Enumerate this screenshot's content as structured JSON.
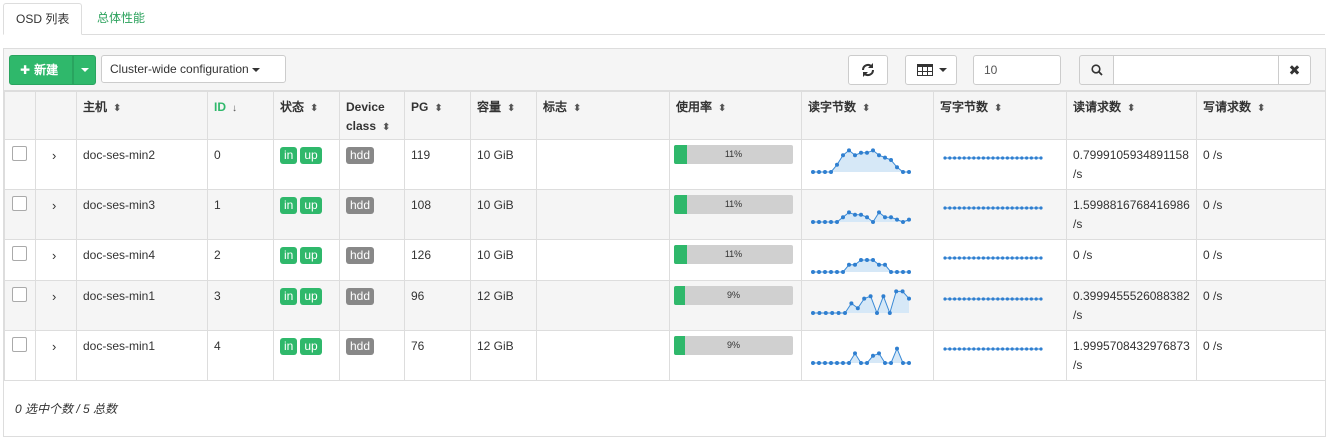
{
  "tabs": [
    {
      "label": "OSD 列表"
    },
    {
      "label": "总体性能"
    }
  ],
  "toolbar": {
    "new_label": "新建",
    "cluster_label": "Cluster-wide configuration",
    "page_size": "10",
    "search_placeholder": "",
    "clear_label": "✖"
  },
  "columns": [
    {
      "label": "",
      "key": "select"
    },
    {
      "label": "",
      "key": "expand"
    },
    {
      "label": "主机",
      "sort": "⬍"
    },
    {
      "label": "ID",
      "sort": "↓"
    },
    {
      "label": "状态",
      "sort": "⬍"
    },
    {
      "label": "Device class",
      "sort": "⬍"
    },
    {
      "label": "PG",
      "sort": "⬍"
    },
    {
      "label": "容量",
      "sort": "⬍"
    },
    {
      "label": "标志",
      "sort": "⬍"
    },
    {
      "label": "使用率",
      "sort": "⬍"
    },
    {
      "label": "读字节数",
      "sort": "⬍"
    },
    {
      "label": "写字节数",
      "sort": "⬍"
    },
    {
      "label": "读请求数",
      "sort": "⬍"
    },
    {
      "label": "写请求数",
      "sort": "⬍"
    }
  ],
  "rows": [
    {
      "host": "doc-ses-min2",
      "id": "0",
      "status": [
        "in",
        "up"
      ],
      "device_class": "hdd",
      "pg": "119",
      "size": "10 GiB",
      "flags": "",
      "usage_pct": 11,
      "usage_label": "11%",
      "read_bytes": [
        0,
        0,
        0,
        0,
        3,
        7,
        9,
        7,
        8,
        8,
        9,
        7,
        6,
        5,
        2,
        0,
        0
      ],
      "write_bytes": [
        1,
        1,
        1,
        1,
        1,
        1,
        1,
        1,
        1,
        1,
        1,
        1,
        1,
        1,
        1,
        1,
        1,
        1,
        1,
        1,
        1
      ],
      "read_ops": "0.7999105934891158 /s",
      "write_ops": "0 /s"
    },
    {
      "host": "doc-ses-min3",
      "id": "1",
      "status": [
        "in",
        "up"
      ],
      "device_class": "hdd",
      "pg": "108",
      "size": "10 GiB",
      "flags": "",
      "usage_pct": 11,
      "usage_label": "11%",
      "read_bytes": [
        0,
        0,
        0,
        0,
        0,
        2,
        4,
        3,
        3,
        2,
        0,
        4,
        2,
        2,
        1,
        0,
        1
      ],
      "write_bytes": [
        1,
        1,
        1,
        1,
        1,
        1,
        1,
        1,
        1,
        1,
        1,
        1,
        1,
        1,
        1,
        1,
        1,
        1,
        1,
        1,
        1
      ],
      "read_ops": "1.5998816768416986 /s",
      "write_ops": "0 /s"
    },
    {
      "host": "doc-ses-min4",
      "id": "2",
      "status": [
        "in",
        "up"
      ],
      "device_class": "hdd",
      "pg": "126",
      "size": "10 GiB",
      "flags": "",
      "usage_pct": 11,
      "usage_label": "11%",
      "read_bytes": [
        0,
        0,
        0,
        0,
        0,
        0,
        3,
        3,
        5,
        5,
        5,
        3,
        3,
        0,
        0,
        0,
        0
      ],
      "write_bytes": [
        1,
        1,
        1,
        1,
        1,
        1,
        1,
        1,
        1,
        1,
        1,
        1,
        1,
        1,
        1,
        1,
        1,
        1,
        1,
        1,
        1
      ],
      "read_ops": "0 /s",
      "write_ops": "0 /s"
    },
    {
      "host": "doc-ses-min1",
      "id": "3",
      "status": [
        "in",
        "up"
      ],
      "device_class": "hdd",
      "pg": "96",
      "size": "12 GiB",
      "flags": "",
      "usage_pct": 9,
      "usage_label": "9%",
      "read_bytes": [
        0,
        0,
        0,
        0,
        0,
        0,
        4,
        2,
        6,
        7,
        0,
        7,
        0,
        9,
        9,
        6
      ],
      "write_bytes": [
        1,
        1,
        1,
        1,
        1,
        1,
        1,
        1,
        1,
        1,
        1,
        1,
        1,
        1,
        1,
        1,
        1,
        1,
        1,
        1,
        1
      ],
      "read_ops": "0.3999455526088382 /s",
      "write_ops": "0 /s"
    },
    {
      "host": "doc-ses-min1",
      "id": "4",
      "status": [
        "in",
        "up"
      ],
      "device_class": "hdd",
      "pg": "76",
      "size": "12 GiB",
      "flags": "",
      "usage_pct": 9,
      "usage_label": "9%",
      "read_bytes": [
        0,
        0,
        0,
        0,
        0,
        0,
        0,
        4,
        0,
        0,
        3,
        4,
        0,
        0,
        6,
        0,
        0
      ],
      "write_bytes": [
        1,
        1,
        1,
        1,
        1,
        1,
        1,
        1,
        1,
        1,
        1,
        1,
        1,
        1,
        1,
        1,
        1,
        1,
        1,
        1,
        1
      ],
      "read_ops": "1.9995708432976873 /s",
      "write_ops": "0 /s"
    }
  ],
  "footer": "0 选中个数 / 5 总数"
}
